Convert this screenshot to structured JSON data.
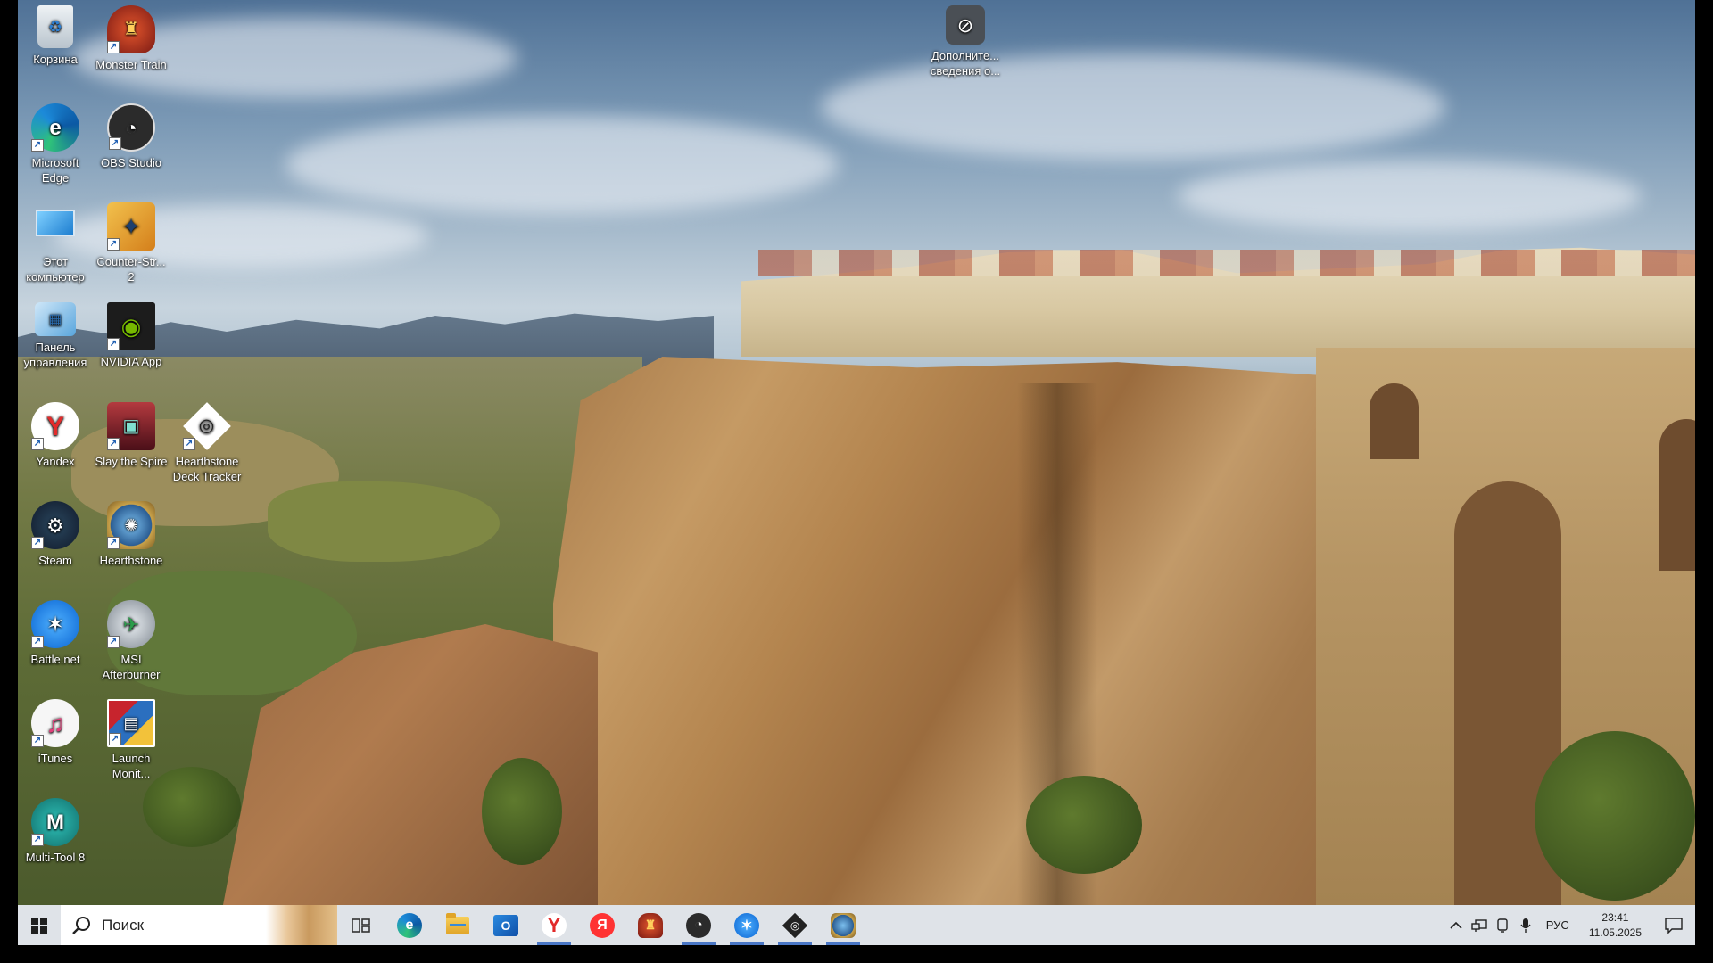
{
  "desktop": {
    "icons": [
      {
        "label": "Корзина",
        "icon": "recycle-bin-icon",
        "color": "#d6dee6"
      },
      {
        "label": "Monster Train",
        "icon": "monster-train-icon",
        "color": "#b8332a"
      },
      {
        "label": "Microsoft Edge",
        "icon": "edge-icon",
        "color": "#1c8ad9"
      },
      {
        "label": "OBS Studio",
        "icon": "obs-icon",
        "color": "#2b2b2b"
      },
      {
        "label": "Этот компьютер",
        "icon": "this-pc-icon",
        "color": "#3b98e0"
      },
      {
        "label": "Counter-Str... 2",
        "icon": "counter-strike-icon",
        "color": "#e2a23a"
      },
      {
        "label": "Панель управления",
        "icon": "control-panel-icon",
        "color": "#5aa6dd"
      },
      {
        "label": "NVIDIA App",
        "icon": "nvidia-icon",
        "color": "#1c1c1c"
      },
      {
        "label": "Yandex",
        "icon": "yandex-icon",
        "color": "#ffffff"
      },
      {
        "label": "Slay the Spire",
        "icon": "slay-the-spire-icon",
        "color": "#7a1e2a"
      },
      {
        "label": "Hearthstone Deck Tracker",
        "icon": "hearthstone-deck-tracker-icon",
        "color": "#ffffff"
      },
      {
        "label": "Steam",
        "icon": "steam-icon",
        "color": "#1b2838"
      },
      {
        "label": "Hearthstone",
        "icon": "hearthstone-icon",
        "color": "#3a6fa8"
      },
      {
        "label": "Battle.net",
        "icon": "battlenet-icon",
        "color": "#148eff"
      },
      {
        "label": "MSI Afterburner",
        "icon": "msi-afterburner-icon",
        "color": "#6a7078"
      },
      {
        "label": "iTunes",
        "icon": "itunes-icon",
        "color": "#f3f3f3"
      },
      {
        "label": "Launch Monit...",
        "icon": "launch-monitor-icon",
        "color": "#c7242d"
      },
      {
        "label": "Multi-Tool 8",
        "icon": "multi-tool-icon",
        "color": "#1e9e9a"
      },
      {
        "label": "Дополните... сведения о...",
        "icon": "additional-info-icon",
        "color": "#595f66"
      }
    ]
  },
  "taskbar": {
    "start_icon": "windows-start-icon",
    "search_placeholder": "Поиск",
    "apps": [
      {
        "name": "task-view",
        "icon": "task-view-icon",
        "color": "#3a3a3a",
        "glyph": "",
        "active": false
      },
      {
        "name": "edge",
        "icon": "edge-icon",
        "color": "#1c8ad9",
        "glyph": "e",
        "active": false
      },
      {
        "name": "file-explorer",
        "icon": "folder-icon",
        "color": "#f0b52e",
        "glyph": "",
        "active": false
      },
      {
        "name": "outlook",
        "icon": "outlook-icon",
        "color": "#1565c0",
        "glyph": "O",
        "active": false
      },
      {
        "name": "yandex-browser",
        "icon": "yandex-browser-icon",
        "color": "#e22a2a",
        "glyph": "Y",
        "active": true
      },
      {
        "name": "yandex",
        "icon": "yandex-icon",
        "color": "#ff3333",
        "glyph": "Я",
        "active": false
      },
      {
        "name": "monster-train",
        "icon": "monster-train-icon",
        "color": "#b8332a",
        "glyph": "",
        "active": false
      },
      {
        "name": "obs",
        "icon": "obs-icon",
        "color": "#2b2b2b",
        "glyph": "",
        "active": true
      },
      {
        "name": "battlenet",
        "icon": "battlenet-icon",
        "color": "#148eff",
        "glyph": "",
        "active": true
      },
      {
        "name": "hearthstone-deck-tracker",
        "icon": "hearthstone-deck-tracker-icon",
        "color": "#222222",
        "glyph": "",
        "active": true
      },
      {
        "name": "hearthstone",
        "icon": "hearthstone-icon",
        "color": "#3a6fa8",
        "glyph": "",
        "active": true
      }
    ],
    "tray": {
      "chevron_icon": "chevron-up-icon",
      "network_icon": "network-icon",
      "device_icon": "device-icon",
      "mic_icon": "microphone-icon",
      "language": "РУС",
      "time": "23:41",
      "date": "11.05.2025",
      "notification_icon": "notification-icon"
    }
  }
}
